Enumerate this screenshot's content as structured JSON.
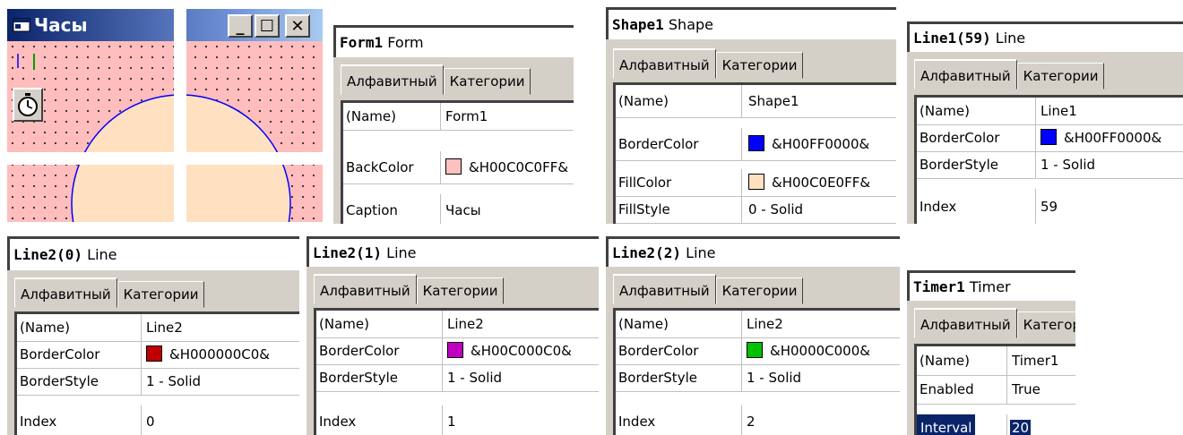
{
  "form_window": {
    "title": "Часы",
    "min_label": "_",
    "max_label": "☐",
    "close_label": "✕",
    "icons": {
      "app": "form-icon",
      "timer": "stopwatch-icon"
    },
    "colors": {
      "back": "#FFC0C0",
      "shape_fill": "#FFE0C0",
      "shape_border": "#0000FF"
    }
  },
  "panels": [
    {
      "object_name": "Form1",
      "object_type": "Form",
      "tabs": [
        "Алфавитный",
        "Категории"
      ],
      "rows": [
        {
          "name": "(Name)",
          "value": "Form1"
        },
        {
          "name": "BackColor",
          "value": "&H00C0C0FF&",
          "swatch": "#FFC0C0"
        },
        {
          "name": "Caption",
          "value": "Часы"
        }
      ]
    },
    {
      "object_name": "Shape1",
      "object_type": "Shape",
      "tabs": [
        "Алфавитный",
        "Категории"
      ],
      "rows": [
        {
          "name": "(Name)",
          "value": "Shape1"
        },
        {
          "name": "BorderColor",
          "value": "&H00FF0000&",
          "swatch": "#0000FF"
        },
        {
          "name": "FillColor",
          "value": "&H00C0E0FF&",
          "swatch": "#FFE0C0"
        },
        {
          "name": "FillStyle",
          "value": "0 - Solid"
        }
      ]
    },
    {
      "object_name": "Line1(59)",
      "object_type": "Line",
      "tabs": [
        "Алфавитный",
        "Категории"
      ],
      "rows": [
        {
          "name": "(Name)",
          "value": "Line1"
        },
        {
          "name": "BorderColor",
          "value": "&H00FF0000&",
          "swatch": "#0000FF"
        },
        {
          "name": "BorderStyle",
          "value": "1 - Solid"
        },
        {
          "name": "Index",
          "value": "59"
        }
      ]
    },
    {
      "object_name": "Line2(0)",
      "object_type": "Line",
      "tabs": [
        "Алфавитный",
        "Категории"
      ],
      "rows": [
        {
          "name": "(Name)",
          "value": "Line2"
        },
        {
          "name": "BorderColor",
          "value": "&H000000C0&",
          "swatch": "#C00000"
        },
        {
          "name": "BorderStyle",
          "value": "1 - Solid"
        },
        {
          "name": "Index",
          "value": "0"
        }
      ]
    },
    {
      "object_name": "Line2(1)",
      "object_type": "Line",
      "tabs": [
        "Алфавитный",
        "Категории"
      ],
      "rows": [
        {
          "name": "(Name)",
          "value": "Line2"
        },
        {
          "name": "BorderColor",
          "value": "&H00C000C0&",
          "swatch": "#C000C0"
        },
        {
          "name": "BorderStyle",
          "value": "1 - Solid"
        },
        {
          "name": "Index",
          "value": "1"
        }
      ]
    },
    {
      "object_name": "Line2(2)",
      "object_type": "Line",
      "tabs": [
        "Алфавитный",
        "Категории"
      ],
      "rows": [
        {
          "name": "(Name)",
          "value": "Line2"
        },
        {
          "name": "BorderColor",
          "value": "&H0000C000&",
          "swatch": "#00C000"
        },
        {
          "name": "BorderStyle",
          "value": "1 - Solid"
        },
        {
          "name": "Index",
          "value": "2"
        }
      ]
    },
    {
      "object_name": "Timer1",
      "object_type": "Timer",
      "tabs": [
        "Алфавитный",
        "Категории"
      ],
      "rows": [
        {
          "name": "(Name)",
          "value": "Timer1"
        },
        {
          "name": "Enabled",
          "value": "True"
        },
        {
          "name": "Interval",
          "value": "20",
          "selected": true
        }
      ]
    }
  ]
}
